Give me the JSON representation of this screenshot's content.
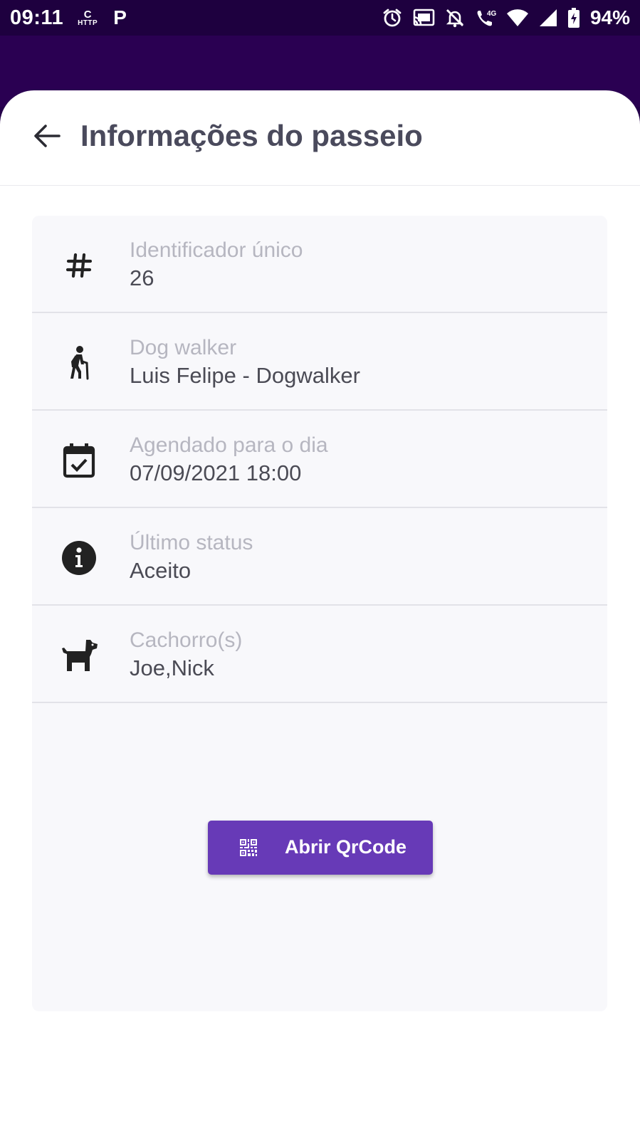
{
  "status_bar": {
    "time": "09:11",
    "http_top": "C",
    "http_bottom": "HTTP",
    "p_label": "P",
    "network": "4G",
    "battery": "94%"
  },
  "header": {
    "title": "Informações do passeio",
    "back_icon": "arrow-left-icon"
  },
  "info_rows": [
    {
      "icon": "hash-icon",
      "label": "Identificador único",
      "value": "26"
    },
    {
      "icon": "hiker-icon",
      "label": "Dog walker",
      "value": "Luis Felipe - Dogwalker"
    },
    {
      "icon": "calendar-check-icon",
      "label": "Agendado para o dia",
      "value": "07/09/2021 18:00"
    },
    {
      "icon": "info-icon",
      "label": "Último status",
      "value": "Aceito"
    },
    {
      "icon": "dog-icon",
      "label": "Cachorro(s)",
      "value": "Joe,Nick"
    }
  ],
  "qr_button": {
    "label": "Abrir QrCode",
    "icon": "qr-code-icon"
  },
  "colors": {
    "status_bar": "#1e003f",
    "header_bg": "#2a0052",
    "accent": "#673ab7",
    "title_text": "#4a4a5c",
    "label_text": "#b6b6c0",
    "value_text": "#4b4b55",
    "card_bg": "#f8f8fb"
  }
}
